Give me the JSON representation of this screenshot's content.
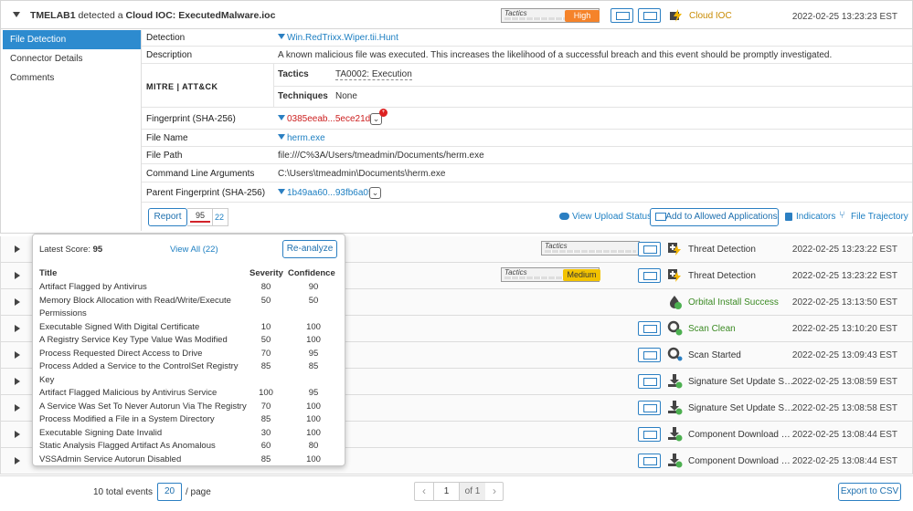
{
  "header": {
    "host": "TMELAB1",
    "detected_text": "detected a",
    "ioc": "Cloud IOC: ExecutedMalware.ioc",
    "tactics_label": "Tactics",
    "severity": "High",
    "category": "Cloud IOC",
    "timestamp": "2022-02-25 13:23:23 EST"
  },
  "tabs": [
    "File Detection",
    "Connector Details",
    "Comments"
  ],
  "details": {
    "detection_label": "Detection",
    "detection_value": "Win.RedTrixx.Wiper.tii.Hunt",
    "description_label": "Description",
    "description_value": "A known malicious file was executed. This increases the likelihood of a successful breach and this event should be promptly investigated.",
    "mitre_logo": "MITRE | ATT&CK",
    "tactics_label": "Tactics",
    "tactics_value": "TA0002: Execution",
    "techniques_label": "Techniques",
    "techniques_value": "None",
    "fingerprint_label": "Fingerprint (SHA-256)",
    "fingerprint_value": "0385eeab...5ece21da",
    "filename_label": "File Name",
    "filename_value": "herm.exe",
    "filepath_label": "File Path",
    "filepath_value": "file:///C%3A/Users/tmeadmin/Documents/herm.exe",
    "cmdline_label": "Command Line Arguments",
    "cmdline_value": "C:\\Users\\tmeadmin\\Documents\\herm.exe",
    "parent_label": "Parent Fingerprint (SHA-256)",
    "parent_value": "1b49aa60...93fb6a05"
  },
  "actions": {
    "report": "Report",
    "score": "95",
    "score_total": "22",
    "view_upload": "View Upload Status",
    "add_allowed": "Add to Allowed Applications",
    "indicators": "Indicators",
    "trajectory": "File Trajectory"
  },
  "popup": {
    "latest_label": "Latest Score:",
    "latest_value": "95",
    "view_all": "View All (22)",
    "reanalyze": "Re-analyze",
    "col_title": "Title",
    "col_severity": "Severity",
    "col_confidence": "Confidence",
    "rows": [
      {
        "title": "Artifact Flagged by Antivirus",
        "title2": "",
        "severity": "80",
        "confidence": "90"
      },
      {
        "title": "Memory Block Allocation with Read/Write/Execute",
        "title2": "Permissions",
        "severity": "50",
        "confidence": "50"
      },
      {
        "title": "Executable Signed With Digital Certificate",
        "title2": "",
        "severity": "10",
        "confidence": "100"
      },
      {
        "title": "A Registry Service Key Type Value Was Modified",
        "title2": "",
        "severity": "50",
        "confidence": "100"
      },
      {
        "title": "Process Requested Direct Access to Drive",
        "title2": "",
        "severity": "70",
        "confidence": "95"
      },
      {
        "title": "Process Added a Service to the ControlSet Registry",
        "title2": "Key",
        "severity": "85",
        "confidence": "85"
      },
      {
        "title": "Artifact Flagged Malicious by Antivirus Service",
        "title2": "",
        "severity": "100",
        "confidence": "95"
      },
      {
        "title": "A Service Was Set To Never Autorun Via The Registry",
        "title2": "",
        "severity": "70",
        "confidence": "100"
      },
      {
        "title": "Process Modified a File in a System Directory",
        "title2": "",
        "severity": "85",
        "confidence": "100"
      },
      {
        "title": "Executable Signing Date Invalid",
        "title2": "",
        "severity": "30",
        "confidence": "100"
      },
      {
        "title": "Static Analysis Flagged Artifact As Anomalous",
        "title2": "",
        "severity": "60",
        "confidence": "80"
      },
      {
        "title": "VSSAdmin Service Autorun Disabled",
        "title2": "",
        "severity": "85",
        "confidence": "100"
      }
    ]
  },
  "events": [
    {
      "name": "Threat Detection",
      "time": "2022-02-25 13:23:22 EST",
      "tactics": "Tactics",
      "severity": "",
      "color": "default"
    },
    {
      "name": "Threat Detection",
      "time": "2022-02-25 13:23:22 EST",
      "tactics": "Tactics",
      "severity": "Medium",
      "color": "default"
    },
    {
      "name": "Orbital Install Success",
      "time": "2022-02-25 13:13:50 EST",
      "tactics": "",
      "severity": "",
      "color": "green"
    },
    {
      "name": "Scan Clean",
      "time": "2022-02-25 13:10:20 EST",
      "tactics": "",
      "severity": "",
      "color": "green"
    },
    {
      "name": "Scan Started",
      "time": "2022-02-25 13:09:43 EST",
      "tactics": "",
      "severity": "",
      "color": "default"
    },
    {
      "name": "Signature Set Update Suc...",
      "time": "2022-02-25 13:08:59 EST",
      "tactics": "",
      "severity": "",
      "color": "default"
    },
    {
      "name": "Signature Set Update Suc...",
      "time": "2022-02-25 13:08:58 EST",
      "tactics": "",
      "severity": "",
      "color": "default"
    },
    {
      "name": "Component Download Su...",
      "time": "2022-02-25 13:08:44 EST",
      "tactics": "",
      "severity": "",
      "color": "default"
    },
    {
      "name": "Component Download Su...",
      "time": "2022-02-25 13:08:44 EST",
      "tactics": "",
      "severity": "",
      "color": "default"
    }
  ],
  "footer": {
    "total": "10 total events",
    "per_page_value": "20",
    "per_page_label": "/ page",
    "page_value": "1",
    "of_pages": "of 1",
    "export": "Export to CSV"
  },
  "colors": {
    "accent": "#2d8bcf",
    "high": "#f5832a",
    "medium": "#f2c200",
    "link": "#1d7fc2"
  }
}
